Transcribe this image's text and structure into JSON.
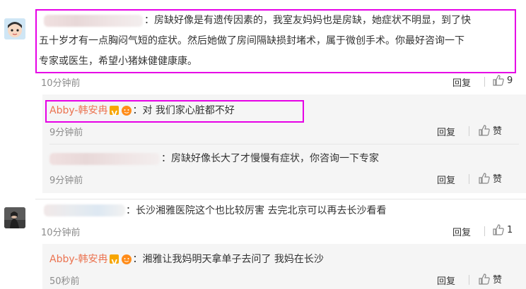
{
  "colors": {
    "author": "#eb7350",
    "highlight": "#e600e6",
    "nested_bg": "#f5f5f5",
    "time": "#8c8c8c"
  },
  "comments": [
    {
      "text_line1": "：房缺好像是有遗传因素的，我室友妈妈也是房缺，她症状不明显，到了快",
      "text_line2": "五十岁才有一点胸闷气短的症状。然后她做了房间隔缺损封堵术，属于微创手术。你最好咨询一下",
      "text_line3": "专家或医生，希望小猪妹健健康康。",
      "time": "10分钟前",
      "reply_label": "回复",
      "like_count": "9"
    },
    {
      "author": "Abby-韩安冉",
      "text": "：对 我们家心脏都不好",
      "time": "9分钟前",
      "reply_label": "回复",
      "like_label": "赞"
    },
    {
      "text": "：房缺好像长大了才慢慢有症状，你咨询一下专家",
      "time": "9分钟前",
      "reply_label": "回复",
      "like_label": "赞"
    },
    {
      "text": "：长沙湘雅医院这个也比较厉害 去完北京可以再去长沙看看",
      "time": "10分钟前",
      "reply_label": "回复",
      "like_count": "1"
    },
    {
      "author": "Abby-韩安冉",
      "text": "：湘雅让我妈明天拿单子去问了 我妈在长沙",
      "time": "50秒前",
      "reply_label": "回复",
      "like_label": "赞"
    }
  ]
}
